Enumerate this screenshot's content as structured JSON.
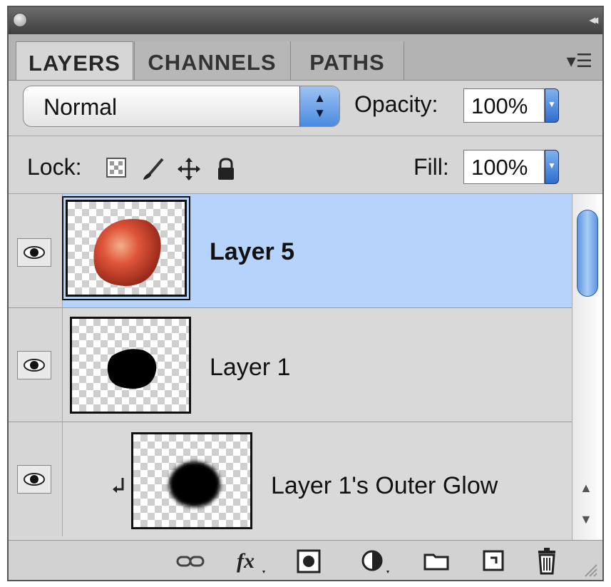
{
  "tabs": [
    {
      "label": "LAYERS"
    },
    {
      "label": "CHANNELS"
    },
    {
      "label": "PATHS"
    }
  ],
  "blend_mode": {
    "value": "Normal"
  },
  "opacity": {
    "label": "Opacity:",
    "value": "100%"
  },
  "lock": {
    "label": "Lock:",
    "icons": [
      "transparency-lock-icon",
      "paint-brush-icon",
      "move-icon",
      "padlock-icon"
    ]
  },
  "fill": {
    "label": "Fill:",
    "value": "100%"
  },
  "layers": [
    {
      "name": "Layer 5",
      "selected": true,
      "visible": true,
      "thumbnail": "red-apple"
    },
    {
      "name": "Layer 1",
      "selected": false,
      "visible": true,
      "thumbnail": "black-blob"
    },
    {
      "name": "Layer 1's Outer Glow",
      "selected": false,
      "visible": true,
      "thumbnail": "blurred-black-blob",
      "clipped": true
    }
  ],
  "footer_icons": [
    "link-icon",
    "fx-icon",
    "layer-mask-icon",
    "adjustment-layer-icon",
    "group-folder-icon",
    "new-layer-icon",
    "trash-icon"
  ],
  "colors": {
    "selected_row": "#b6d4fb",
    "accent_blue": "#4a8ae0",
    "panel_bg": "#d6d6d6"
  }
}
